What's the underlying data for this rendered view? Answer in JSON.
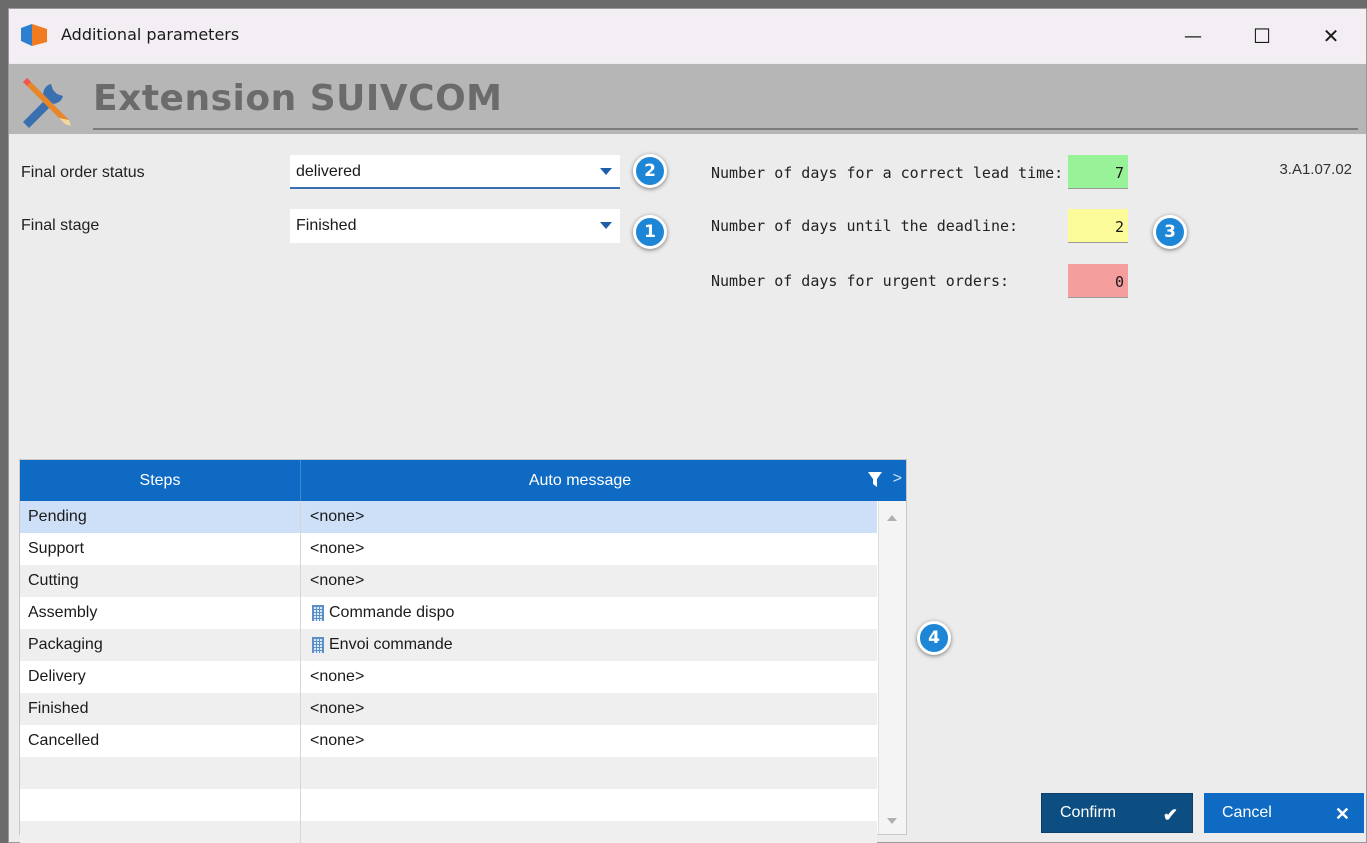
{
  "window": {
    "title": "Additional parameters",
    "minimize_label": "—",
    "maximize_label": "☐",
    "close_label": "✕"
  },
  "banner": {
    "title": "Extension SUIVCOM"
  },
  "form": {
    "final_order_status_label": "Final order status",
    "final_order_status_value": "delivered",
    "final_stage_label": "Final stage",
    "final_stage_value": "Finished",
    "lead_time_label": "Number of days for a correct lead time:",
    "lead_time_value": "7",
    "deadline_label": "Number of days until the deadline:",
    "deadline_value": "2",
    "urgent_label": "Number of days for urgent orders:",
    "urgent_value": "0",
    "version": "3.A1.07.02"
  },
  "colors": {
    "lead_time_bg": "#98f298",
    "deadline_bg": "#fbfb9a",
    "urgent_bg": "#f59e9e",
    "accent": "#0e6ac3"
  },
  "badges": {
    "b1": "1",
    "b2": "2",
    "b3": "3",
    "b4": "4"
  },
  "grid": {
    "col_steps": "Steps",
    "col_auto_message": "Auto message",
    "more_label": ">",
    "rows": [
      {
        "step": "Pending",
        "message": "<none>",
        "icon": ""
      },
      {
        "step": "Support",
        "message": "<none>",
        "icon": ""
      },
      {
        "step": "Cutting",
        "message": "<none>",
        "icon": ""
      },
      {
        "step": "Assembly",
        "message": "Commande dispo",
        "icon": "building-icon"
      },
      {
        "step": "Packaging",
        "message": "Envoi commande",
        "icon": "building-icon"
      },
      {
        "step": "Delivery",
        "message": "<none>",
        "icon": ""
      },
      {
        "step": "Finished",
        "message": "<none>",
        "icon": ""
      },
      {
        "step": "Cancelled",
        "message": "<none>",
        "icon": ""
      }
    ]
  },
  "buttons": {
    "confirm": "Confirm",
    "confirm_icon": "✔",
    "cancel": "Cancel",
    "cancel_icon": "✕"
  }
}
